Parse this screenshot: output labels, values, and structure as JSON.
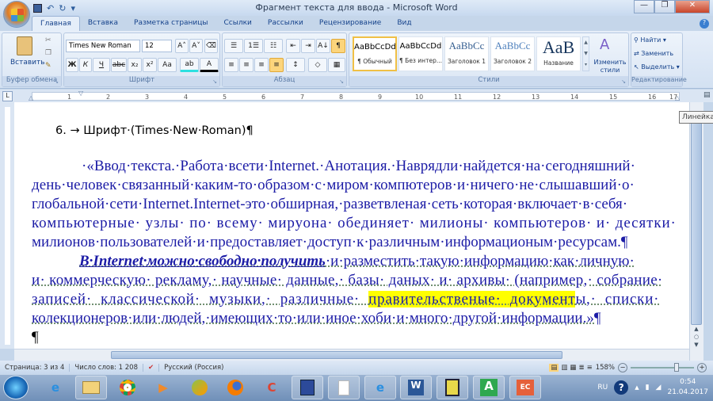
{
  "window": {
    "title": "Фрагмент текста для ввода - Microsoft Word"
  },
  "qat": {
    "save_icon": "save-icon",
    "undo": "↶",
    "redo": "↻",
    "customize": "▾"
  },
  "window_buttons": {
    "minimize": "—",
    "restore": "❐",
    "close": "✕"
  },
  "tabs": [
    "Главная",
    "Вставка",
    "Разметка страницы",
    "Ссылки",
    "Рассылки",
    "Рецензирование",
    "Вид"
  ],
  "ribbon": {
    "clipboard": {
      "paste": "Вставить",
      "label": "Буфер обмена"
    },
    "font": {
      "name": "Times New Roman",
      "size": "12",
      "grow": "A˄",
      "shrink": "A˅",
      "clear": "⌫",
      "bold": "Ж",
      "italic": "К",
      "underline": "Ч",
      "strike": "abc",
      "sub": "x₂",
      "sup": "x²",
      "case": "Aa",
      "highlight": "ab",
      "color": "A",
      "label": "Шрифт"
    },
    "paragraph": {
      "bullets": "☰",
      "numbering": "1☰",
      "multilevel": "☷",
      "dec_indent": "⇤",
      "inc_indent": "⇥",
      "sort": "A↓",
      "pilcrow": "¶",
      "align_left": "≡",
      "align_center": "≡",
      "align_right": "≡",
      "justify": "≡",
      "spacing": "↕",
      "shading": "◇",
      "borders": "▦",
      "label": "Абзац"
    },
    "styles": {
      "items": [
        {
          "sample": "AaBbCcDd",
          "name": "¶ Обычный"
        },
        {
          "sample": "AaBbCcDd",
          "name": "¶ Без интер..."
        },
        {
          "sample": "AaBbCc",
          "name": "Заголовок 1"
        },
        {
          "sample": "AaBbCc",
          "name": "Заголовок 2"
        },
        {
          "sample": "AaB",
          "name": "Название"
        }
      ],
      "change": "Изменить стили",
      "label": "Стили"
    },
    "editing": {
      "find": "Найти ▾",
      "replace": "Заменить",
      "select": "Выделить ▾",
      "label": "Редактирование"
    }
  },
  "ruler": {
    "numbers": [
      "1",
      "2",
      "3",
      "4",
      "5",
      "6",
      "7",
      "8",
      "9",
      "10",
      "11",
      "12",
      "13",
      "14",
      "15",
      "16",
      "17"
    ],
    "tab_selector": "L",
    "tooltip": "Линейка"
  },
  "document": {
    "heading": "6. → Шрифт·(Times·New·Roman)¶",
    "p1": [
      "·«Ввод·текста.·Работа·всети·Internet.·Анотация.·Наврядли·найдется·на·сегодняшний·",
      "день·человек·связанный·каким-то·образом·с·миром·компютеров·и·ничего·не·слышавший·о·",
      "глобальной·сети·Internet.Internet-это·обширная,·разветвленая·сеть·которая·включает·в·себя·",
      "компьютерные· узлы· по· всему· мируона· обединяет· милионы· компьютеров· и· десятки·",
      "милионов·пользователей·и·предоставляет·доступ·к·различным·информационым·ресурсам.¶"
    ],
    "p2": {
      "emph": "В·Internet·можно·свободно·получить",
      "l1_rest": "·и·разместить·такую·информацию·как·личную·",
      "l2": "и· коммерческую· рекламу,· научные· данные,· базы· даных· и· архивы· (например,· собрание·",
      "l3_a": "записей·  классической·  музыки,·  различные·  ",
      "l3_hl": "правительственые·  документ",
      "l3_b": "ы,·  списки·",
      "l4": "колекционеров·или·людей,·имеющих·то·или·иное·хоби·и·много·другой·информации.»¶",
      "empty": "¶"
    }
  },
  "status": {
    "page": "Страница: 3 из 4",
    "words": "Число слов: 1 208",
    "language": "Русский (Россия)",
    "zoom": "158%",
    "zoom_level_percent": 158
  },
  "taskbar": {
    "apps": [
      "internet-explorer",
      "file-explorer",
      "chrome",
      "media-player",
      "app-green-orange",
      "firefox",
      "ccleaner",
      "floppy-save",
      "blank-document",
      "internet-explorer-2",
      "word",
      "app-person",
      "app-green-a",
      "app-ec"
    ],
    "labels": {
      "green_a": "A",
      "ec": "EC",
      "word": "W"
    },
    "tray": {
      "lang": "RU",
      "help": "?",
      "show_hidden": "▲",
      "time": "0:54",
      "date": "21.04.2017"
    }
  }
}
